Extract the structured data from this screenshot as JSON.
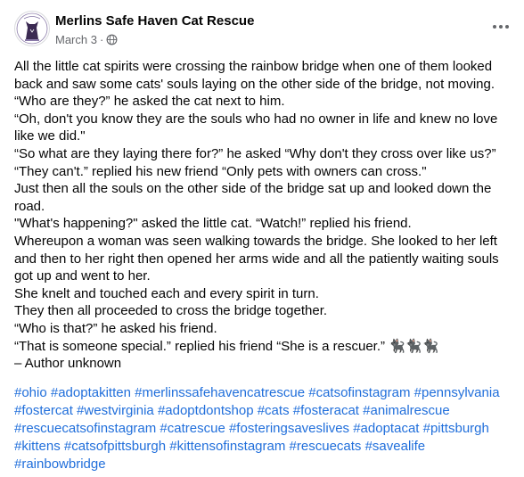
{
  "post": {
    "author": "Merlins Safe Haven Cat Rescue",
    "logo_text": "Merlin's Safe Haven",
    "date": "March 3",
    "separator": "·",
    "privacy_icon": "globe-icon",
    "lines": [
      "All the little cat spirits were crossing the rainbow bridge when one of them looked",
      "back and saw some cats' souls laying on the other side of the bridge, not moving.",
      "“Who are they?” he asked the cat next to him.",
      "“Oh, don't you know they are the souls who had no owner in life and knew no love",
      "like we did.\"",
      "“So what are they laying there for?” he asked “Why don't they cross over like us?”",
      "“They can't.” replied his new friend “Only pets with owners can cross.\"",
      "Just then all the souls on the other side of the bridge sat up and looked down the",
      "road.",
      "\"What's happening?\" asked the little cat. “Watch!” replied his friend.",
      "Whereupon a woman was seen walking towards the bridge. She looked to her left",
      "and then to her right then opened her arms wide and all the patiently waiting souls",
      "got up and went to her.",
      "She knelt and touched each and every spirit in turn.",
      "They then all proceeded to cross the bridge together.",
      "“Who is that?” he asked his friend.",
      "“That is someone special.” replied his friend “She is a rescuer.” 🐈‍⬛🐈‍⬛🐈‍⬛",
      "– Author unknown"
    ],
    "hashtags": [
      "#ohio",
      "#adoptakitten",
      "#merlinssafehavencatrescue",
      "#catsofinstagram",
      "#pennsylvania",
      "#fostercat",
      "#westvirginia",
      "#adoptdontshop",
      "#cats",
      "#fosteracat",
      "#animalrescue",
      "#rescuecatsofinstagram",
      "#catrescue",
      "#fosteringsaveslives",
      "#adoptacat",
      "#pittsburgh",
      "#kittens",
      "#catsofpittsburgh",
      "#kittensofinstagram",
      "#rescuecats",
      "#savealife",
      "#rainbowbridge"
    ]
  },
  "colors": {
    "text": "#050505",
    "meta": "#65676b",
    "link": "#216fdb"
  }
}
